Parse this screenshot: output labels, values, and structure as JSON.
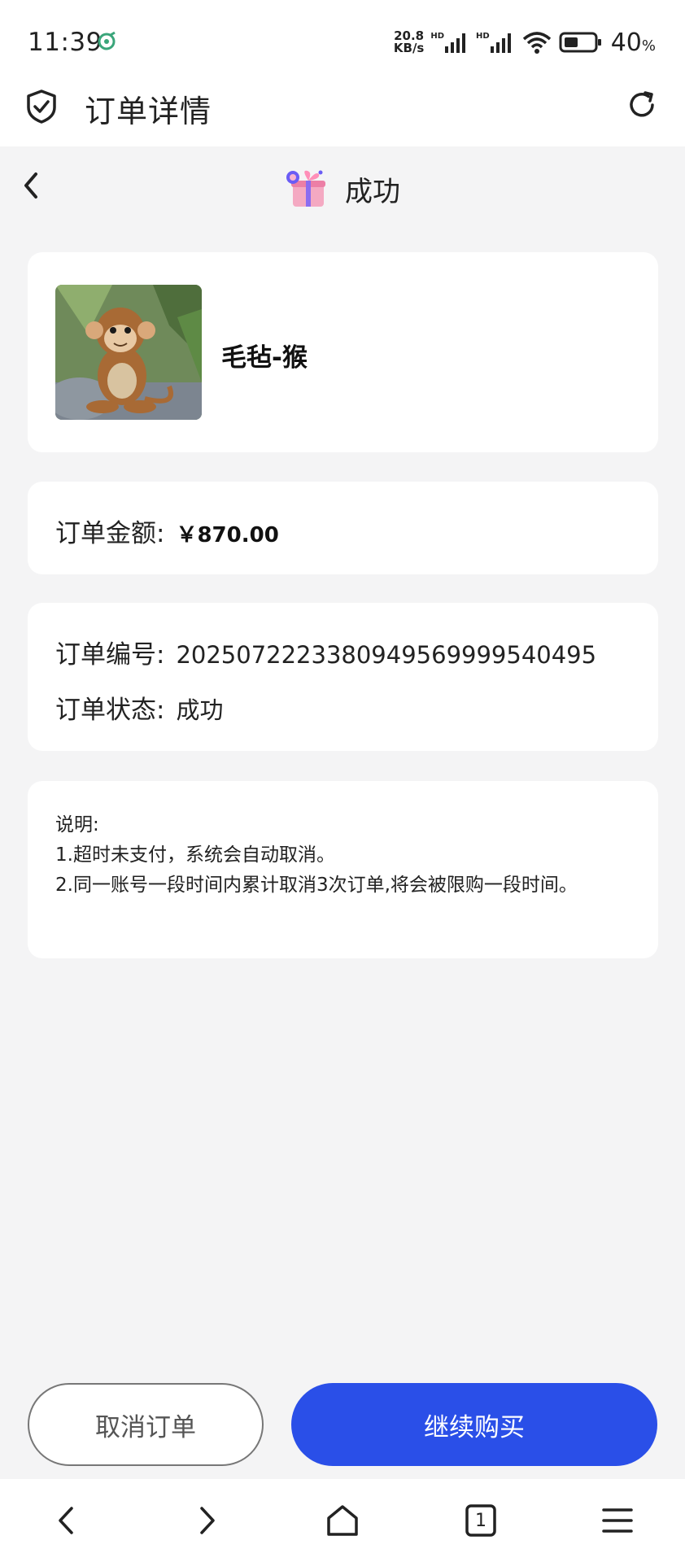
{
  "status_bar": {
    "time": "11:39",
    "net_speed_value": "20.8",
    "net_speed_unit": "KB/s",
    "signal_label_1": "HD",
    "signal_label_2": "HD",
    "battery_percent": "40",
    "battery_percent_sign": "%"
  },
  "header": {
    "title": "订单详情"
  },
  "page": {
    "status_heading": "成功"
  },
  "product": {
    "name": "毛毡-猴"
  },
  "order": {
    "amount_label": "订单金额:",
    "amount_value": "￥870.00",
    "number_label": "订单编号:",
    "number_value": "20250722233809495699995404​95",
    "status_label": "订单状态:",
    "status_value": "成功"
  },
  "notes": {
    "title": "说明:",
    "line1": "1.超时未支付，系统会自动取消。",
    "line2": "2.同一账号一段时间内累计取消3次订单,将会被限购一段时间。"
  },
  "actions": {
    "cancel_label": "取消订单",
    "continue_label": "继续购买"
  },
  "bottom_nav": {
    "tab_count": "1"
  },
  "colors": {
    "accent": "#2a4fe8",
    "background": "#f4f4f5",
    "card": "#ffffff"
  }
}
